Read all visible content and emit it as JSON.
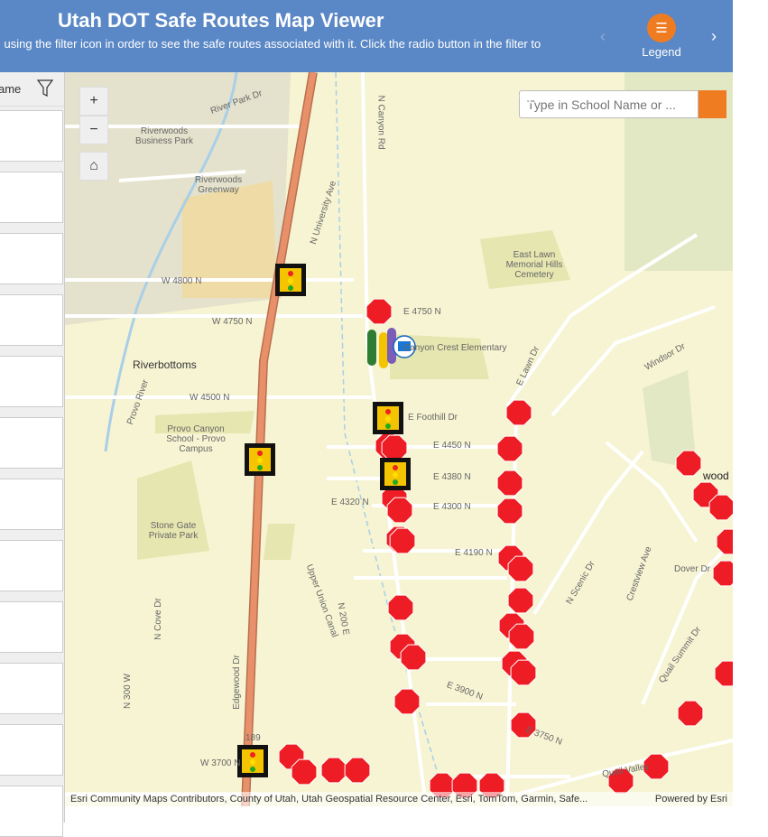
{
  "header": {
    "title": "Utah DOT Safe Routes Map Viewer",
    "subtitle": "l using the filter icon in order to see the safe routes associated with it. Click the radio button in the filter to",
    "legend_label": "Legend",
    "prev": "‹",
    "next": "›"
  },
  "panel": {
    "header_label": "ame",
    "card_count": 12
  },
  "map": {
    "zoom_in": "+",
    "zoom_out": "−",
    "home": "⌂",
    "search_placeholder": "Type in School Name or ...",
    "attribution": "Esri Community Maps Contributors, County of Utah, Utah Geospatial Resource Center, Esri, TomTom, Garmin, Safe...",
    "powered_by": "Powered by Esri",
    "labels": [
      "River Park Dr",
      "Riverwoods Business Park",
      "Riverwoods Greenway",
      "W 4800 N",
      "W 4750 N",
      "E 4750 N",
      "Riverbottoms",
      "Canyon Crest Elementary",
      "W 4500 N",
      "Provo Canyon School - Provo Campus",
      "E Foothill Dr",
      "E 4450 N",
      "E 4380 N",
      "E 4320 N",
      "E 4300 N",
      "Stone Gate Private Park",
      "E 4190 N",
      "East Lawn Memorial Hills Cemetery",
      "N University Ave",
      "N Canyon Rd",
      "E Lawn Dr",
      "Windsor Dr",
      "Dover Dr",
      "N Scenic Dr",
      "Crestview Ave",
      "Upper Union Canal",
      "N 200 E",
      "N Cove Dr",
      "Edgewood Dr",
      "N 300 W",
      "E 3900 N",
      "E 3750 N",
      "W 3700 N",
      "Quail Valley",
      "Quail Summit Dr",
      "Provo River",
      "189",
      "wood"
    ],
    "colors": {
      "stop": "#ee1c25",
      "highway": "#e8906a",
      "header": "#5a87c5",
      "accent": "#f07c22"
    }
  }
}
